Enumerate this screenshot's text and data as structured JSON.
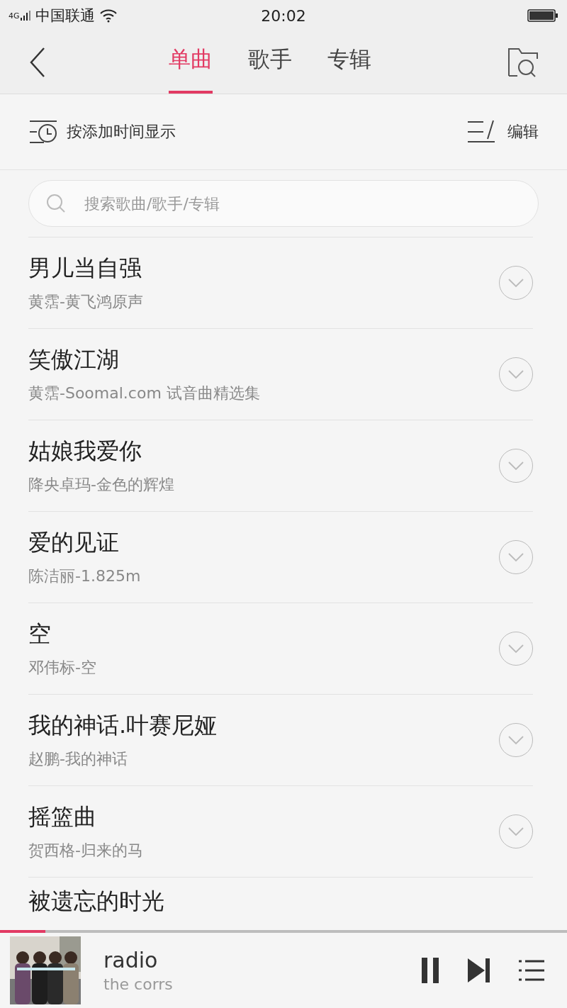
{
  "status_bar": {
    "network": "4G",
    "carrier": "中国联通",
    "time": "20:02"
  },
  "header": {
    "tabs": [
      {
        "label": "单曲",
        "selected": true
      },
      {
        "label": "歌手",
        "selected": false
      },
      {
        "label": "专辑",
        "selected": false
      }
    ]
  },
  "toolbar": {
    "sort_label": "按添加时间显示",
    "edit_label": "编辑"
  },
  "search": {
    "placeholder": "搜索歌曲/歌手/专辑"
  },
  "songs": [
    {
      "title": "男儿当自强",
      "subtitle": "黄霑-黄飞鸿原声"
    },
    {
      "title": "笑傲江湖",
      "subtitle": "黄霑-Soomal.com 试音曲精选集"
    },
    {
      "title": "姑娘我爱你",
      "subtitle": "降央卓玛-金色的辉煌"
    },
    {
      "title": "爱的见证",
      "subtitle": "陈洁丽-1.825m"
    },
    {
      "title": "空",
      "subtitle": "邓伟标-空"
    },
    {
      "title": "我的神话.叶赛尼娅",
      "subtitle": "赵鹏-我的神话"
    },
    {
      "title": "摇篮曲",
      "subtitle": "贺西格-归来的马"
    },
    {
      "title": "被遗忘的时光"
    }
  ],
  "player": {
    "level": 0.08,
    "title": "radio",
    "artist": "the corrs",
    "playing": true
  }
}
